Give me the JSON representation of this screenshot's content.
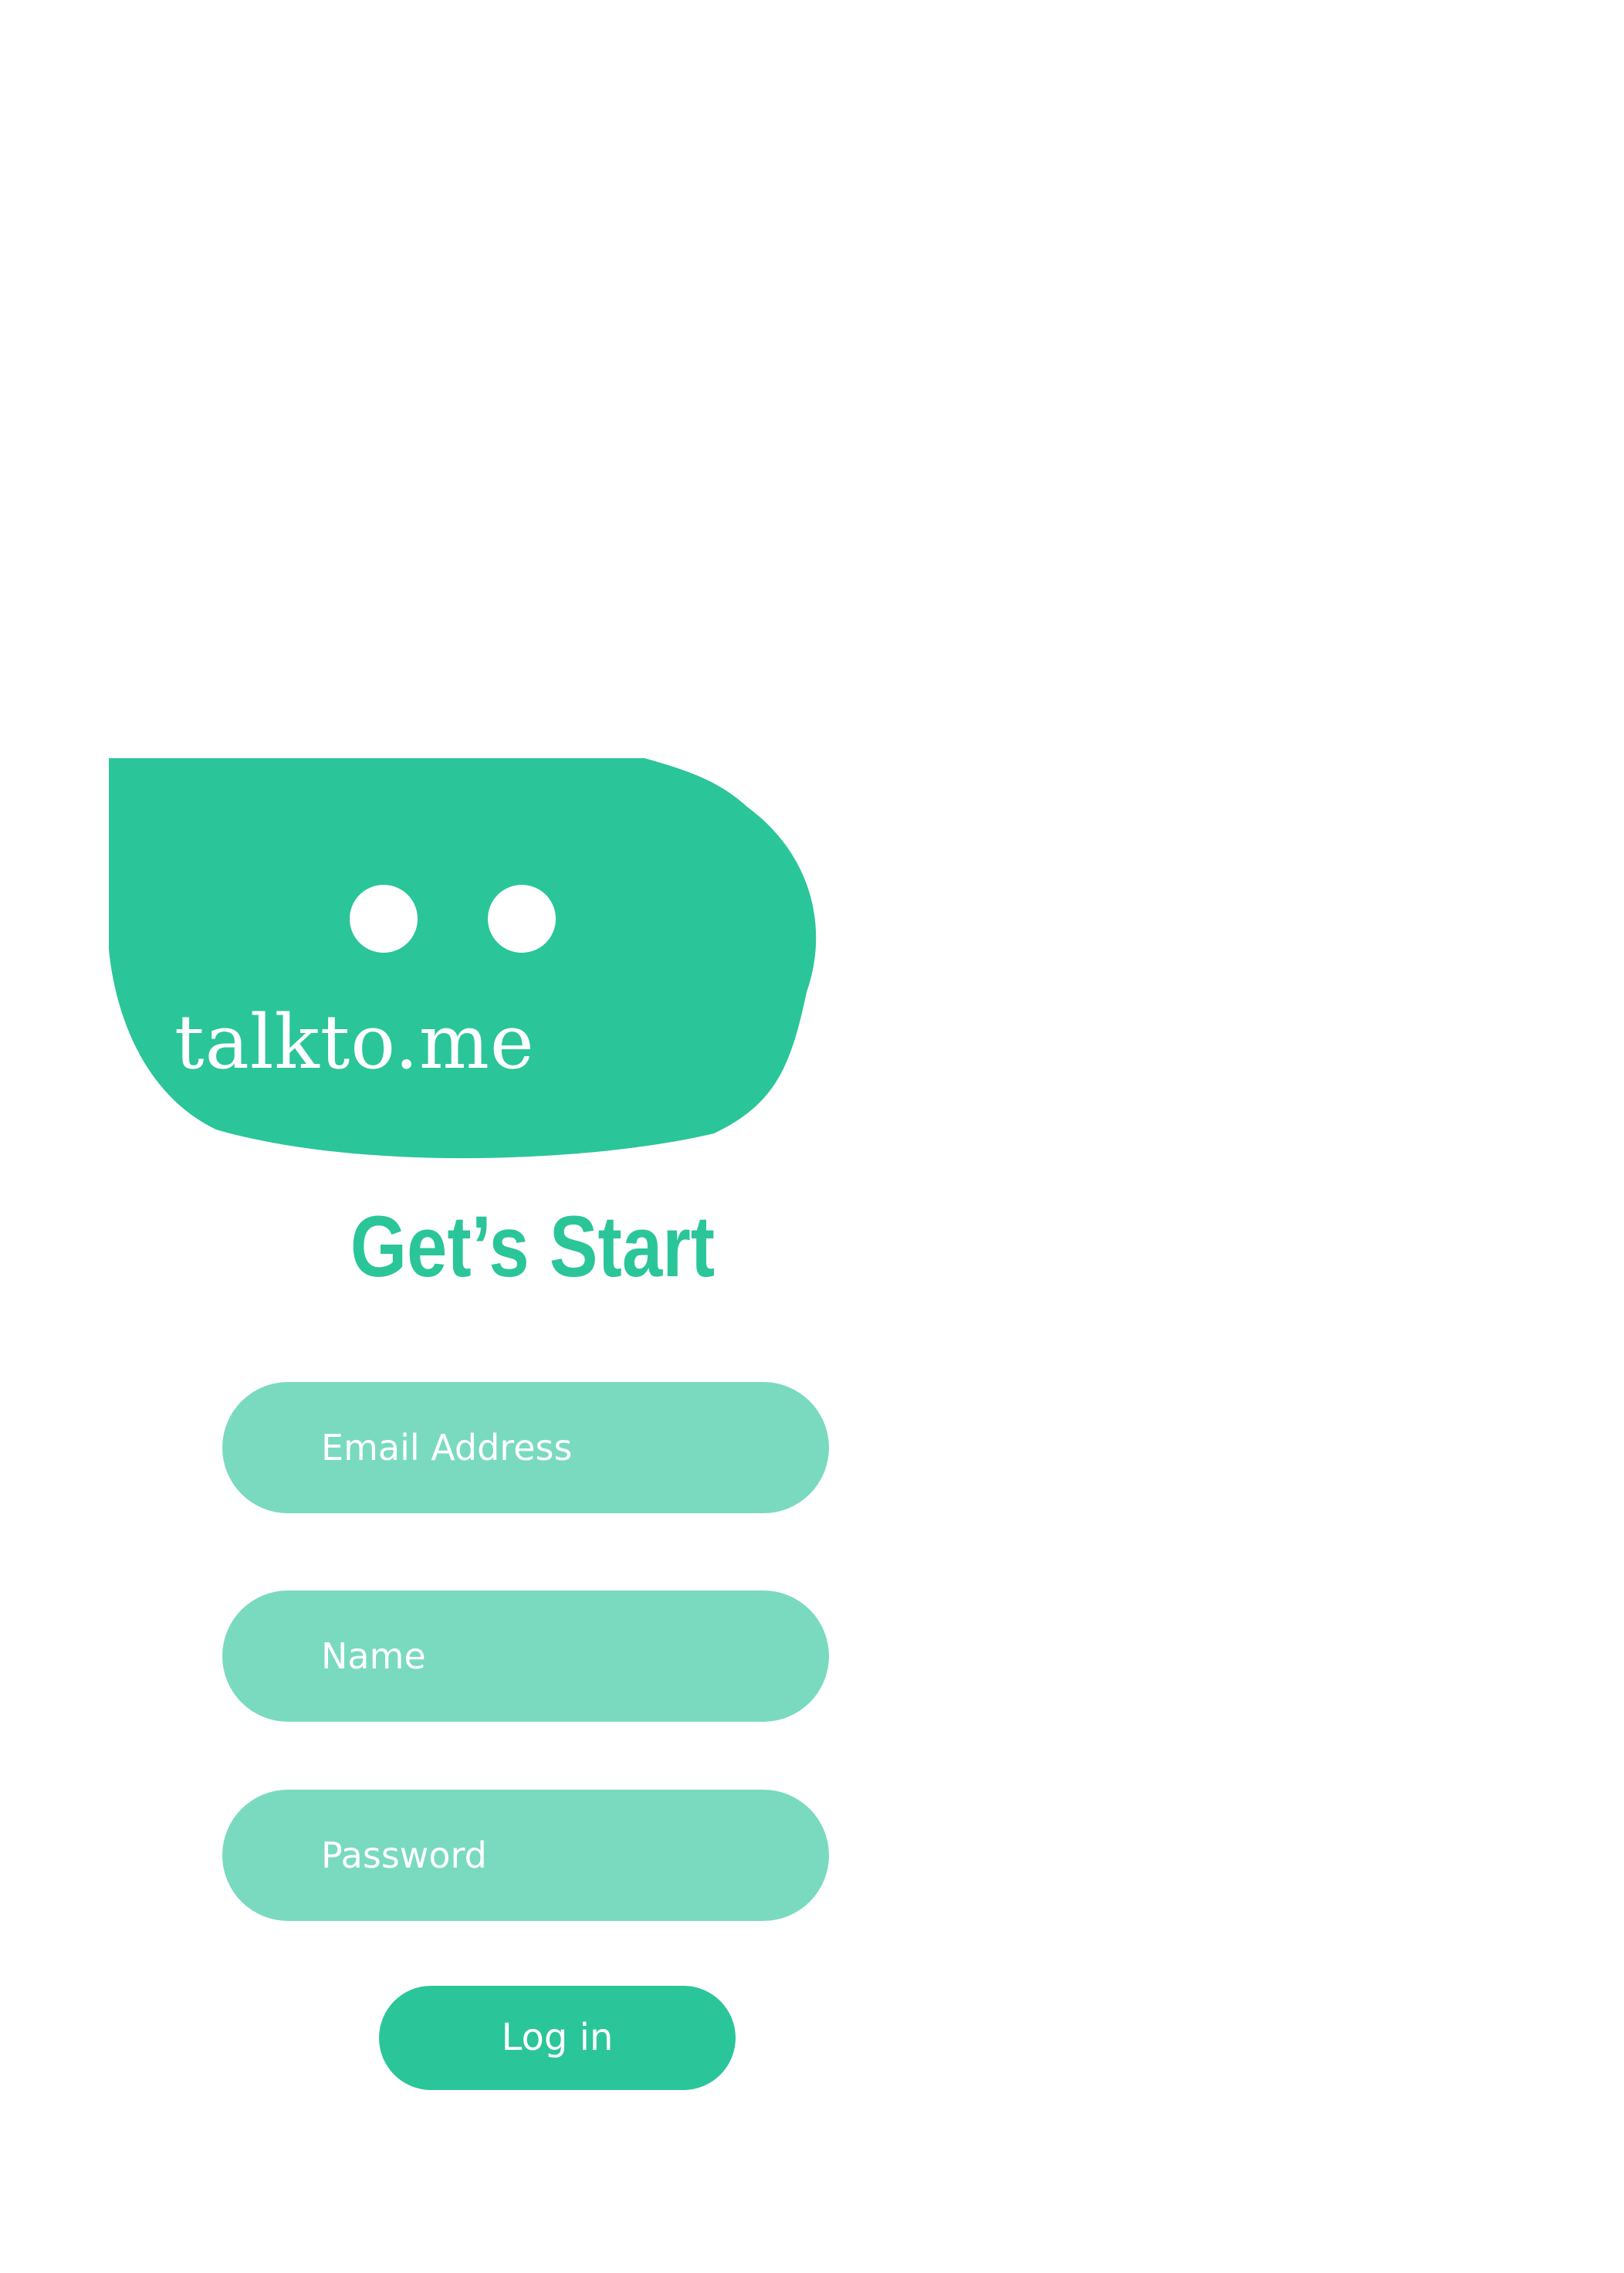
{
  "brand": {
    "name": "talkto.me",
    "color": "#2bc59a"
  },
  "heading": "Get’s Start",
  "form": {
    "email_placeholder": "Email Address",
    "name_placeholder": "Name",
    "password_placeholder": "Password",
    "field_color": "#79dac0"
  },
  "login_label": "Log in"
}
